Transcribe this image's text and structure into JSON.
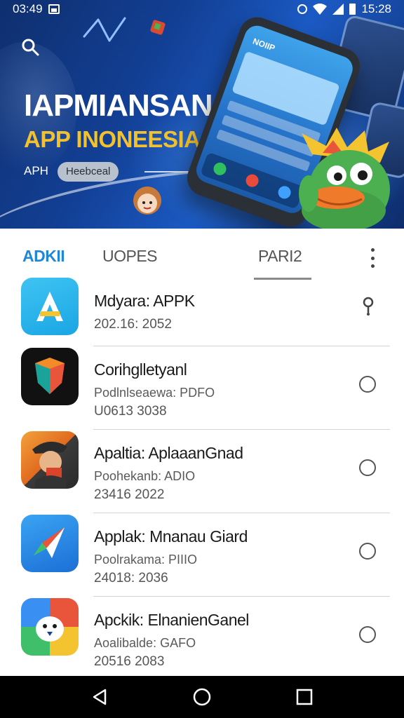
{
  "status_bar": {
    "time_left": "03:49",
    "time_right": "15:28"
  },
  "hero": {
    "title_line1": "IAPMIANSAN",
    "title_line2": "APP  INONEESIA",
    "apk_label": "APH",
    "pill_text": "Heebceal",
    "phone_screen_text": "NOIIP"
  },
  "tabs": [
    {
      "label": "ADKII",
      "active": true
    },
    {
      "label": "UOPES",
      "active": false
    },
    {
      "label": "PARI2",
      "active": false
    }
  ],
  "apps": [
    {
      "name": "Mdyara: APPK",
      "subtitle": "",
      "date": "202.16: 2052",
      "icon": "a-letter-icon",
      "control": "pin"
    },
    {
      "name": "Corihglletyanl",
      "subtitle": "Podlnlseaewa: PDFO",
      "date": "U0613  3038",
      "icon": "shield-icon",
      "control": "radio"
    },
    {
      "name": "Apaltia: AplaaanGnad",
      "subtitle": "Poohekanb: ADIO",
      "date": "23416  2022",
      "icon": "character-icon",
      "control": "radio"
    },
    {
      "name": "Applak: Mnanau Giard",
      "subtitle": "Poolrakama: PIIIO",
      "date": "24018: 2036",
      "icon": "paper-plane-icon",
      "control": "radio"
    },
    {
      "name": "Apckik: ElnanienGanel",
      "subtitle": "Aoalibalde: GAFO",
      "date": "20516  2083",
      "icon": "bird-icon",
      "control": "radio"
    }
  ],
  "colors": {
    "accent": "#1e88d6",
    "hero_title": "#ffffff",
    "hero_subtitle": "#f2c12e",
    "nav_bar": "#000000"
  }
}
